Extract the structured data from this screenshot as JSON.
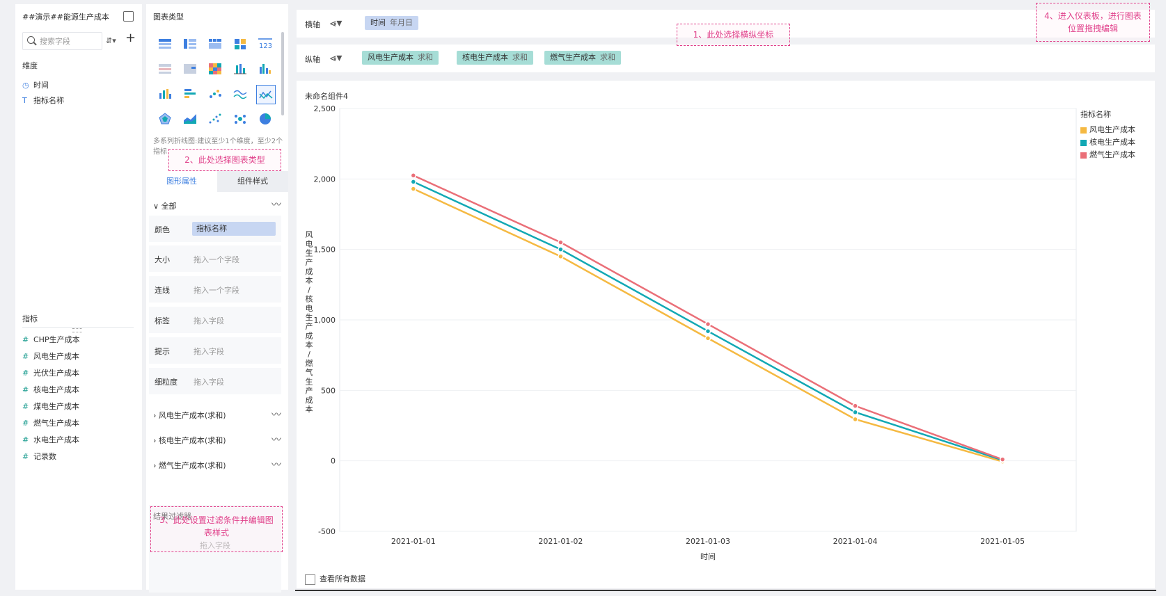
{
  "field_panel": {
    "dataset_title": "##演示##能源生产成本",
    "search_placeholder": "搜索字段",
    "dimension_label": "维度",
    "dimensions": [
      {
        "name": "时间",
        "icon": "clock-icon"
      },
      {
        "name": "指标名称",
        "icon": "text-type-icon"
      }
    ],
    "measure_label": "指标",
    "measures": [
      {
        "name": "CHP生产成本",
        "icon": "hash-icon"
      },
      {
        "name": "风电生产成本",
        "icon": "hash-icon"
      },
      {
        "name": "光伏生产成本",
        "icon": "hash-icon"
      },
      {
        "name": "核电生产成本",
        "icon": "hash-icon"
      },
      {
        "name": "煤电生产成本",
        "icon": "hash-icon"
      },
      {
        "name": "燃气生产成本",
        "icon": "hash-icon"
      },
      {
        "name": "水电生产成本",
        "icon": "hash-icon"
      },
      {
        "name": "记录数",
        "icon": "hash-icon"
      }
    ]
  },
  "config_panel": {
    "chart_type_title": "图表类型",
    "chart_type_hint": "多系列折线图:建议至少1个维度，至少2个指标",
    "tabs": [
      "图形属性",
      "组件样式"
    ],
    "all_label": "全部",
    "props": [
      {
        "label": "颜色",
        "value": "指标名称",
        "filled": true
      },
      {
        "label": "大小",
        "value": "拖入一个字段",
        "filled": false
      },
      {
        "label": "连线",
        "value": "拖入一个字段",
        "filled": false
      },
      {
        "label": "标签",
        "value": "拖入字段",
        "filled": false
      },
      {
        "label": "提示",
        "value": "拖入字段",
        "filled": false
      },
      {
        "label": "细粒度",
        "value": "拖入字段",
        "filled": false
      }
    ],
    "series_rows": [
      "风电生产成本(求和)",
      "核电生产成本(求和)",
      "燃气生产成本(求和)"
    ],
    "filter_title": "结果过滤器",
    "filter_drop": "拖入字段"
  },
  "axes_bar": {
    "x_label": "横轴",
    "y_label": "纵轴",
    "x_chip": {
      "name": "时间",
      "agg": "年月日"
    },
    "y_chips": [
      {
        "name": "风电生产成本",
        "agg": "求和"
      },
      {
        "name": "核电生产成本",
        "agg": "求和"
      },
      {
        "name": "燃气生产成本",
        "agg": "求和"
      }
    ]
  },
  "chart_card": {
    "component_title": "未命名组件4",
    "view_all_label": "查看所有数据"
  },
  "notes": [
    "1、此处选择横纵坐标",
    "2、此处选择图表类型",
    "3、此处设置过滤条件并编辑图表样式",
    "4、进入仪表板，进行图表位置拖拽编辑"
  ],
  "chart_data": {
    "type": "line",
    "title": "",
    "categories": [
      "2021-01-01",
      "2021-01-02",
      "2021-01-03",
      "2021-01-04",
      "2021-01-05"
    ],
    "xlabel": "时间",
    "ylabel": "风电生产成本/核电生产成本/燃气生产成本",
    "ylim": [
      -500,
      2500
    ],
    "yticks": [
      -500,
      0,
      500,
      1000,
      1500,
      2000,
      2500
    ],
    "ytick_labels": [
      "-500",
      "0",
      "500",
      "1,000",
      "1,500",
      "2,000",
      "2,500"
    ],
    "legend_title": "指标名称",
    "legend_position": "right",
    "series": [
      {
        "name": "风电生产成本",
        "color": "#f5b942",
        "values": [
          1930,
          1450,
          870,
          295,
          -5
        ]
      },
      {
        "name": "核电生产成本",
        "color": "#12a8b4",
        "values": [
          1980,
          1500,
          920,
          345,
          5
        ]
      },
      {
        "name": "燃气生产成本",
        "color": "#ea6f78",
        "values": [
          2025,
          1550,
          970,
          390,
          10
        ]
      }
    ]
  }
}
